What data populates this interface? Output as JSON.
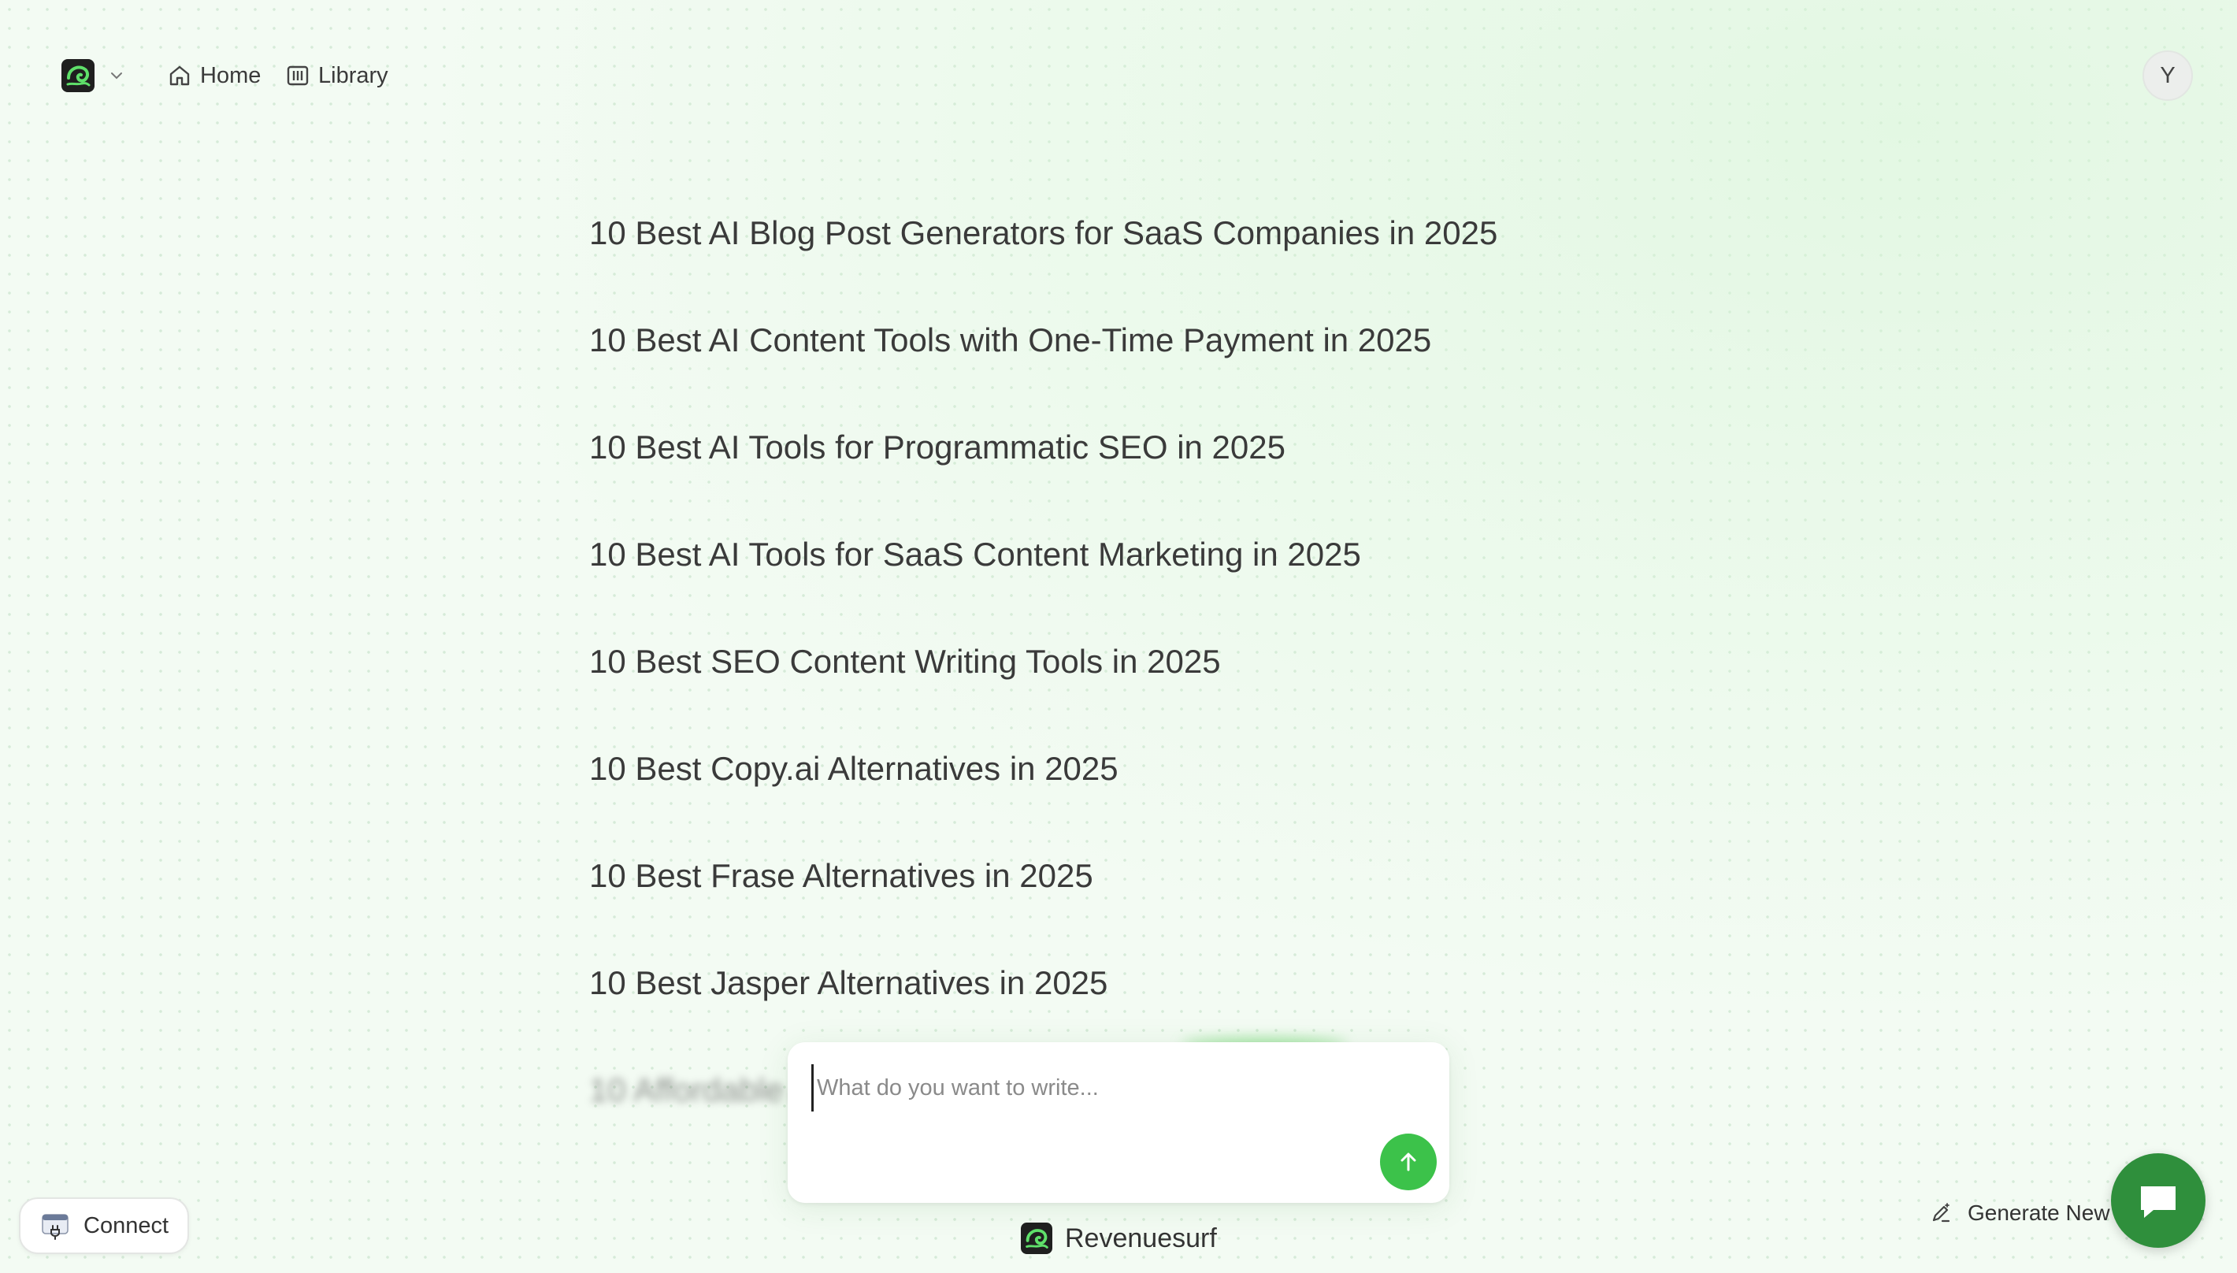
{
  "header": {
    "logo_icon": "revenuesurf-logo-icon",
    "nav": [
      {
        "label": "Home",
        "icon": "home-icon"
      },
      {
        "label": "Library",
        "icon": "library-icon"
      }
    ],
    "avatar_initial": "Y"
  },
  "list": {
    "items": [
      "10 Best AI Blog Post Generators for SaaS Companies in 2025",
      "10 Best AI Content Tools with One-Time Payment in 2025",
      "10 Best AI Tools for Programmatic SEO in 2025",
      "10 Best AI Tools for SaaS Content Marketing in 2025",
      "10 Best SEO Content Writing Tools in 2025",
      "10 Best Copy.ai Alternatives in 2025",
      "10 Best Frase Alternatives in 2025",
      "10 Best Jasper Alternatives in 2025"
    ],
    "blurred_item": "10 Affordable AI Content Tools with One-Time"
  },
  "composer": {
    "placeholder": "What do you want to write...",
    "value": "",
    "send_icon": "arrow-up-icon"
  },
  "footer": {
    "brand": "Revenuesurf",
    "connect_label": "Connect",
    "generate_new_label": "Generate New",
    "chat_icon": "chat-bubble-icon"
  },
  "colors": {
    "accent": "#3cc24a",
    "chat_button": "#2f8f3c",
    "background": "#f3fbf3"
  }
}
